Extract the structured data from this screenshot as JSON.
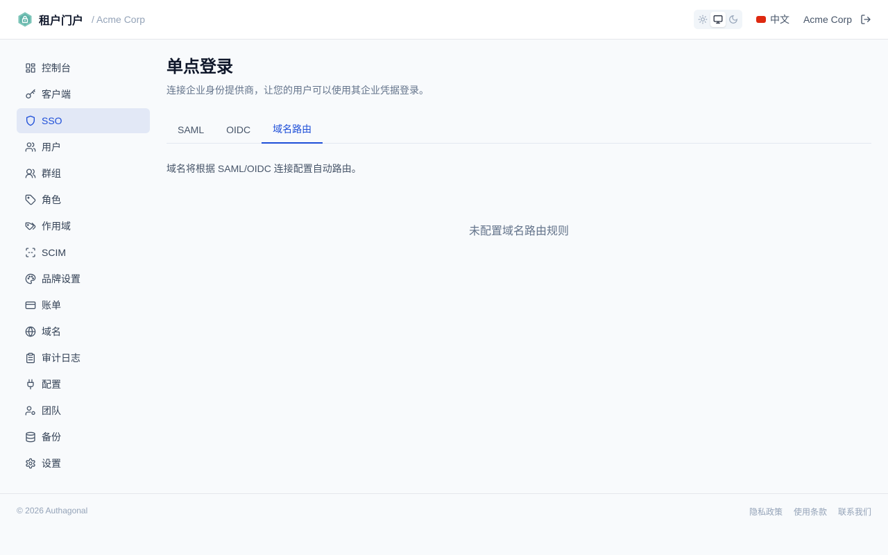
{
  "header": {
    "title": "租户门户",
    "tenant_path": "/ Acme Corp",
    "language": "中文",
    "tenant_name": "Acme Corp"
  },
  "sidebar": {
    "items": [
      {
        "label": "控制台",
        "icon": "dashboard-icon"
      },
      {
        "label": "客户端",
        "icon": "key-icon"
      },
      {
        "label": "SSO",
        "icon": "shield-icon",
        "active": true
      },
      {
        "label": "用户",
        "icon": "users-icon"
      },
      {
        "label": "群组",
        "icon": "group-icon"
      },
      {
        "label": "角色",
        "icon": "tag-icon"
      },
      {
        "label": "作用域",
        "icon": "tags-icon"
      },
      {
        "label": "SCIM",
        "icon": "scan-icon"
      },
      {
        "label": "品牌设置",
        "icon": "palette-icon"
      },
      {
        "label": "账单",
        "icon": "credit-card-icon"
      },
      {
        "label": "域名",
        "icon": "globe-icon"
      },
      {
        "label": "审计日志",
        "icon": "clipboard-icon"
      },
      {
        "label": "配置",
        "icon": "plug-icon"
      },
      {
        "label": "团队",
        "icon": "team-icon"
      },
      {
        "label": "备份",
        "icon": "database-icon"
      },
      {
        "label": "设置",
        "icon": "gear-icon"
      }
    ]
  },
  "main": {
    "title": "单点登录",
    "description": "连接企业身份提供商，让您的用户可以使用其企业凭据登录。",
    "tabs": [
      {
        "label": "SAML"
      },
      {
        "label": "OIDC"
      },
      {
        "label": "域名路由",
        "active": true
      }
    ],
    "routing_note": "域名将根据 SAML/OIDC 连接配置自动路由。",
    "empty_state": "未配置域名路由规则"
  },
  "footer": {
    "copyright": "© 2026 Authagonal",
    "links": [
      {
        "label": "隐私政策"
      },
      {
        "label": "使用条款"
      },
      {
        "label": "联系我们"
      }
    ]
  },
  "colors": {
    "accent": "#1d4ed8",
    "active_bg": "#e2e8f6",
    "logo": "#5fb3a8"
  }
}
